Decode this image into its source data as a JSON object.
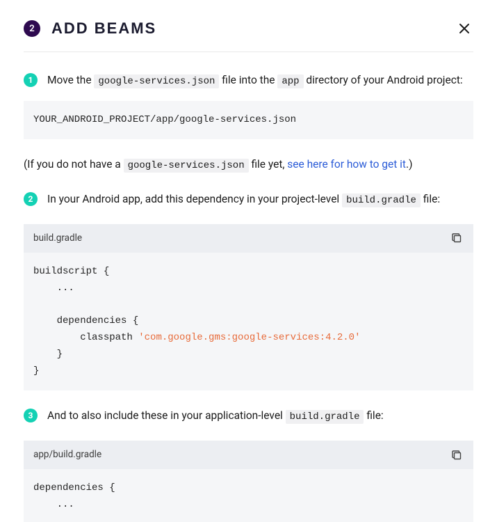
{
  "header": {
    "step_number": "2",
    "title": "ADD BEAMS"
  },
  "steps": {
    "s1": {
      "num": "1",
      "pre": "Move the ",
      "code": "google-services.json",
      "mid": " file into the ",
      "code2": "app",
      "post": " directory of your Android project:"
    },
    "s2": {
      "num": "2",
      "pre": "In your Android app, add this dependency in your project-level ",
      "code": "build.gradle",
      "post": " file:"
    },
    "s3": {
      "num": "3",
      "pre": "And to also include these in your application-level ",
      "code": "build.gradle",
      "post": " file:"
    }
  },
  "path_block": "YOUR_ANDROID_PROJECT/app/google-services.json",
  "note": {
    "pre": "(If you do not have a ",
    "code": "google-services.json",
    "mid": " file yet, ",
    "link": "see here for how to get it",
    "post": ".)"
  },
  "code1": {
    "filename": "build.gradle",
    "line1": "buildscript {",
    "line2": "    ...",
    "line3": "    dependencies {",
    "line4a": "        classpath ",
    "line4b": "'com.google.gms:google-services:4.2.0'",
    "line5": "    }",
    "line6": "}"
  },
  "code2": {
    "filename": "app/build.gradle",
    "line1": "dependencies {",
    "line2": "    ..."
  }
}
